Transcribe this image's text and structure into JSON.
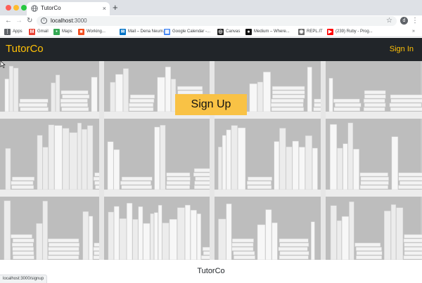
{
  "browser": {
    "tab_title": "TutorCo",
    "tab_close": "×",
    "new_tab": "+",
    "url_host": "localhost",
    "url_port": ":3000",
    "avatar_letter": "d",
    "bookmarks": [
      {
        "label": "Apps",
        "icon": "apps-icon",
        "color": "#5f6368"
      },
      {
        "label": "Gmail",
        "icon": "gmail-icon",
        "color": "#ea4335"
      },
      {
        "label": "Maps",
        "icon": "maps-icon",
        "color": "#34a853"
      },
      {
        "label": "Working...",
        "icon": "microsoft-icon",
        "color": "#f25022"
      },
      {
        "label": "Mail – Dena Neum...",
        "icon": "mail-icon",
        "color": "#0072c6"
      },
      {
        "label": "Google Calendar -...",
        "icon": "calendar-icon",
        "color": "#4285f4"
      },
      {
        "label": "Canvas",
        "icon": "canvas-icon",
        "color": "#222222"
      },
      {
        "label": "Medium – Where...",
        "icon": "medium-icon",
        "color": "#111111"
      },
      {
        "label": "REPL.IT",
        "icon": "replit-icon",
        "color": "#6b6b6b"
      },
      {
        "label": "(239) Ruby - Prog...",
        "icon": "youtube-icon",
        "color": "#ff0000"
      }
    ],
    "bookmarks_more": "»",
    "status_url": "localhost:3000/signup"
  },
  "app": {
    "brand": "TutorCo",
    "signin_label": "Sign In",
    "signup_label": "Sign Up",
    "footer_title": "TutorCo",
    "accent_color": "#ffc107",
    "navbar_color": "#212529",
    "button_color": "#f9c245"
  }
}
